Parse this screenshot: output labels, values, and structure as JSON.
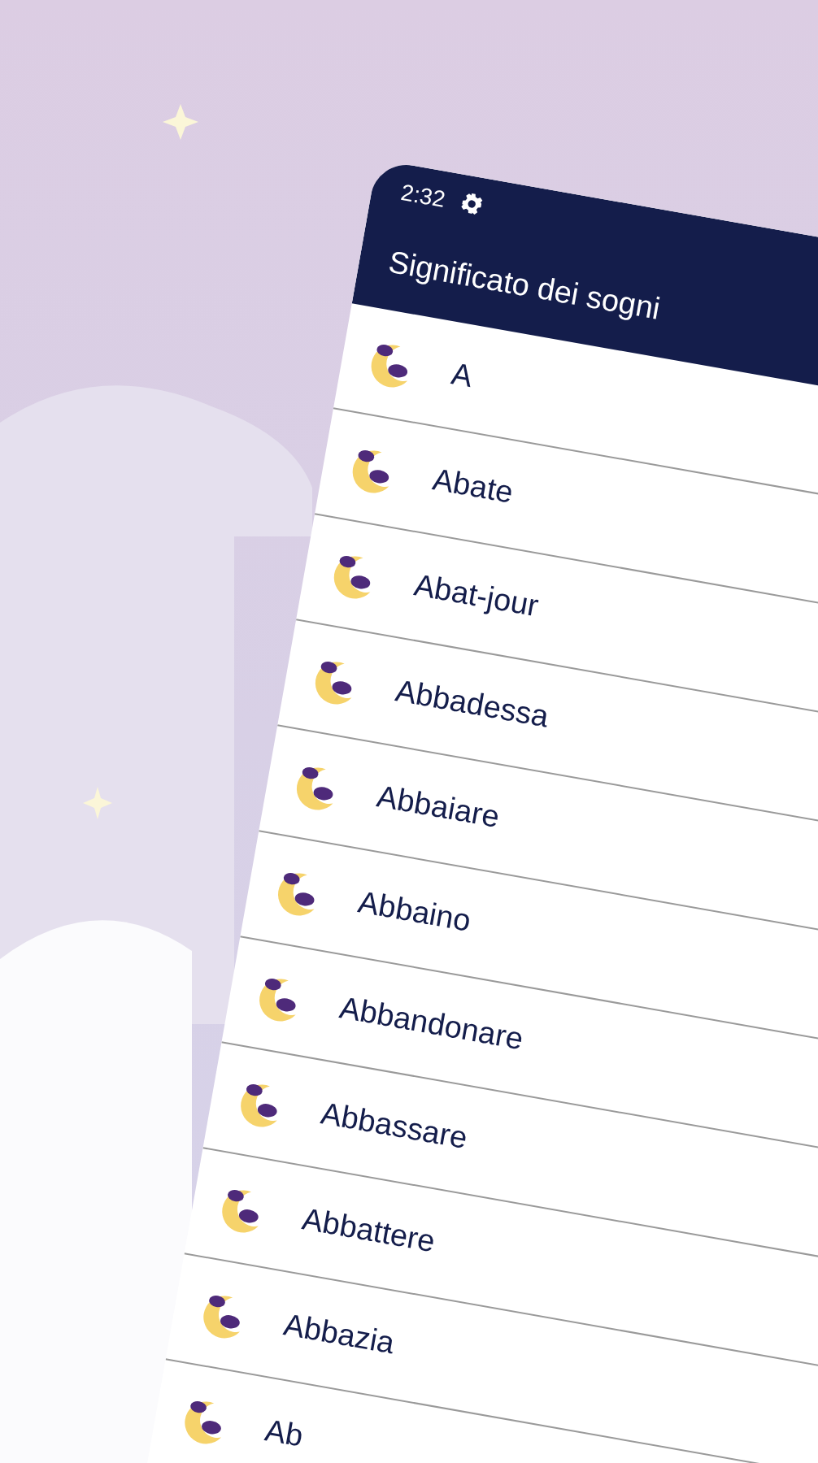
{
  "status_bar": {
    "time": "2:32"
  },
  "app_bar": {
    "title": "Significato dei sogni"
  },
  "entries": [
    {
      "label": "A"
    },
    {
      "label": "Abate"
    },
    {
      "label": "Abat-jour"
    },
    {
      "label": "Abbadessa"
    },
    {
      "label": "Abbaiare"
    },
    {
      "label": "Abbaino"
    },
    {
      "label": "Abbandonare"
    },
    {
      "label": "Abbassare"
    },
    {
      "label": "Abbattere"
    },
    {
      "label": "Abbazia"
    },
    {
      "label": "Ab"
    }
  ]
}
